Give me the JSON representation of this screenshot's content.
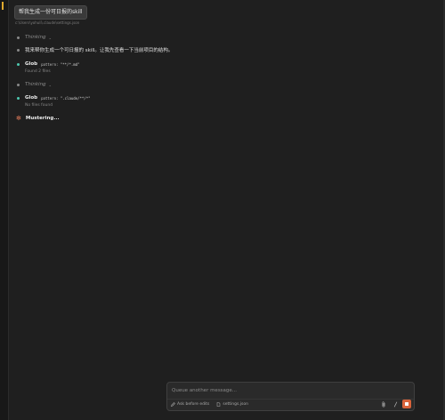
{
  "chat": {
    "user_message": "帮我生成一份可日报的skill",
    "context_file": "c:\\Users\\yohuli\\.claude\\settings.json",
    "items": [
      {
        "type": "thinking",
        "label": "Thinking"
      },
      {
        "type": "text",
        "text": "我来帮你生成一个可日报的 skill。让我先查看一下当前项目的结构。"
      },
      {
        "type": "tool",
        "name": "Glob",
        "param_key": "pattern:",
        "param_value": "\"**/*.md\"",
        "result": "Found 2 files"
      },
      {
        "type": "thinking",
        "label": "Thinking"
      },
      {
        "type": "tool",
        "name": "Glob",
        "param_key": "pattern:",
        "param_value": "\".claude/**/*\"",
        "result": "No files found"
      }
    ],
    "status": "Mustering..."
  },
  "composer": {
    "placeholder": "Queue another message...",
    "mode_label": "Ask before edits",
    "file_chip": "settings.json",
    "icons": {
      "mode": "pencil-icon",
      "file": "file-icon",
      "attach": "paperclip-icon",
      "command": "slash-icon",
      "stop": "stop-icon"
    }
  },
  "colors": {
    "background": "#1f1f1f",
    "accent": "#d9633a",
    "success_dot": "#4ec9b0",
    "spinner": "#d97757"
  }
}
